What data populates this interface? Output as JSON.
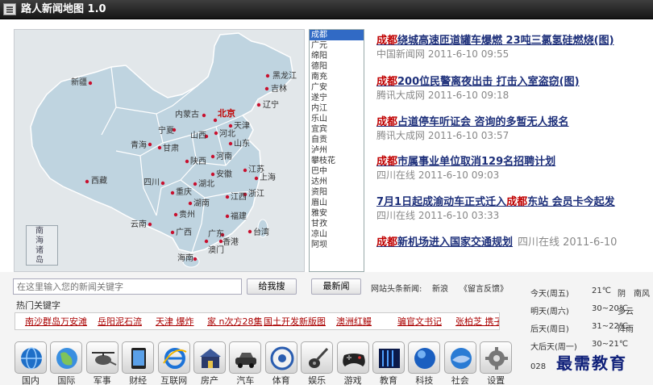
{
  "app": {
    "title": "路人新闻地图 1.0"
  },
  "map": {
    "cities": [
      {
        "id": "xinjiang",
        "name": "新疆"
      },
      {
        "id": "heilongjiang",
        "name": "黑龙江"
      },
      {
        "id": "jilin",
        "name": "吉林"
      },
      {
        "id": "liaoning",
        "name": "辽宁"
      },
      {
        "id": "neimenggu",
        "name": "内蒙古"
      },
      {
        "id": "beijing",
        "name": "北京"
      },
      {
        "id": "tianjin",
        "name": "天津"
      },
      {
        "id": "hebei",
        "name": "河北"
      },
      {
        "id": "ningxia",
        "name": "宁夏"
      },
      {
        "id": "shanxi",
        "name": "山西"
      },
      {
        "id": "shandong",
        "name": "山东"
      },
      {
        "id": "qinghai",
        "name": "青海"
      },
      {
        "id": "gansu",
        "name": "甘肃"
      },
      {
        "id": "henan",
        "name": "河南"
      },
      {
        "id": "shaanxi",
        "name": "陕西"
      },
      {
        "id": "jiangsu",
        "name": "江苏"
      },
      {
        "id": "xizang",
        "name": "西藏"
      },
      {
        "id": "sichuan",
        "name": "四川"
      },
      {
        "id": "anhui",
        "name": "安徽"
      },
      {
        "id": "shanghai",
        "name": "上海"
      },
      {
        "id": "hubei",
        "name": "湖北"
      },
      {
        "id": "chongqing",
        "name": "重庆"
      },
      {
        "id": "zhejiang",
        "name": "浙江"
      },
      {
        "id": "jiangxi",
        "name": "江西"
      },
      {
        "id": "hunan",
        "name": "湖南"
      },
      {
        "id": "guizhou",
        "name": "贵州"
      },
      {
        "id": "fujian",
        "name": "福建"
      },
      {
        "id": "yunnan",
        "name": "云南"
      },
      {
        "id": "taiwan",
        "name": "台湾"
      },
      {
        "id": "guangxi",
        "name": "广西"
      },
      {
        "id": "guangdong",
        "name": "广东"
      },
      {
        "id": "xianggang",
        "name": "香港"
      },
      {
        "id": "aomen",
        "name": "澳门"
      },
      {
        "id": "hainan",
        "name": "海南"
      }
    ],
    "inset": [
      "南",
      "海",
      "诸",
      "岛"
    ]
  },
  "city_list": {
    "items": [
      "成都",
      "广元",
      "绵阳",
      "德阳",
      "南充",
      "广安",
      "遂宁",
      "内江",
      "乐山",
      "宜宾",
      "自贡",
      "泸州",
      "攀枝花",
      "巴中",
      "达州",
      "资阳",
      "眉山",
      "雅安",
      "甘孜",
      "凉山",
      "阿坝"
    ],
    "selected": 0
  },
  "news": {
    "items": [
      {
        "kw": "成都",
        "text": "绕城高速匝道罐车爆燃 23吨三氯氢硅燃烧(图)",
        "source": "中国新闻网 2011-6-10 09:55"
      },
      {
        "kw": "成都",
        "text": "200位民警离夜出击 打击入室盗窃(图)",
        "source": "腾讯大成网 2011-6-10 09:18"
      },
      {
        "kw": "成都",
        "text": "占道停车听证会 咨询的多暂无人报名",
        "source": "腾讯大成网 2011-6-10 03:57"
      },
      {
        "kw": "成都",
        "text": "市属事业单位取消129名招聘计划",
        "source": "四川在线 2011-6-10 09:03"
      },
      {
        "pre": "7月1日起成渝动车正式迁入",
        "kw": "成都",
        "text": "东站 会员卡今起发",
        "source": "四川在线 2011-6-10 03:33"
      },
      {
        "kw": "成都",
        "text": "新机场进入国家交通规划",
        "source": "四川在线 2011-6-10"
      }
    ]
  },
  "search": {
    "placeholder": "在这里输入您的新闻关键字",
    "search_button": "给我搜",
    "latest_button": "最新闻",
    "source_label": "网站头条新闻:",
    "source_value": "新浪",
    "feedback": "《留言反馈》"
  },
  "hot": {
    "label": "热门关键字",
    "keywords": [
      "南沙群岛万安滩",
      "岳阳泥石流",
      "天津 爆炸",
      "家 n次方28集",
      "国土开发新版图",
      "澳洲红鳗",
      "骗官文书记",
      "张柏芝 携子离"
    ]
  },
  "categories": [
    {
      "label": "国内",
      "icon": "globe-blue-icon"
    },
    {
      "label": "国际",
      "icon": "globe-icon"
    },
    {
      "label": "军事",
      "icon": "helicopter-icon"
    },
    {
      "label": "财经",
      "icon": "tablet-icon"
    },
    {
      "label": "互联网",
      "icon": "ie-icon"
    },
    {
      "label": "房产",
      "icon": "house-icon"
    },
    {
      "label": "汽车",
      "icon": "car-icon"
    },
    {
      "label": "体育",
      "icon": "ball-icon"
    },
    {
      "label": "娱乐",
      "icon": "guitar-icon"
    },
    {
      "label": "游戏",
      "icon": "gamepad-icon"
    },
    {
      "label": "教育",
      "icon": "screen-icon"
    },
    {
      "label": "科技",
      "icon": "sphere-icon"
    },
    {
      "label": "社会",
      "icon": "world-icon"
    },
    {
      "label": "设置",
      "icon": "gear-icon"
    }
  ],
  "weather": {
    "days": [
      {
        "day": "今天(周五)",
        "temp": "21℃",
        "cond": "阴",
        "city": "南风"
      },
      {
        "day": "明天(周六)",
        "temp": "30~20℃",
        "cond": "多云",
        "city": ""
      },
      {
        "day": "后天(周日)",
        "temp": "31~22℃",
        "cond": "阵雨",
        "city": ""
      },
      {
        "day": "大后天(周一)",
        "temp": "30~21℃",
        "cond": "",
        "city": ""
      }
    ],
    "phone": "028"
  },
  "watermark": "最需教育",
  "colors": {
    "keyword": "#c00000",
    "headline": "#1d2f7a",
    "map_fill": "#bfd4e0",
    "titlebar": "#2a2a2a"
  }
}
